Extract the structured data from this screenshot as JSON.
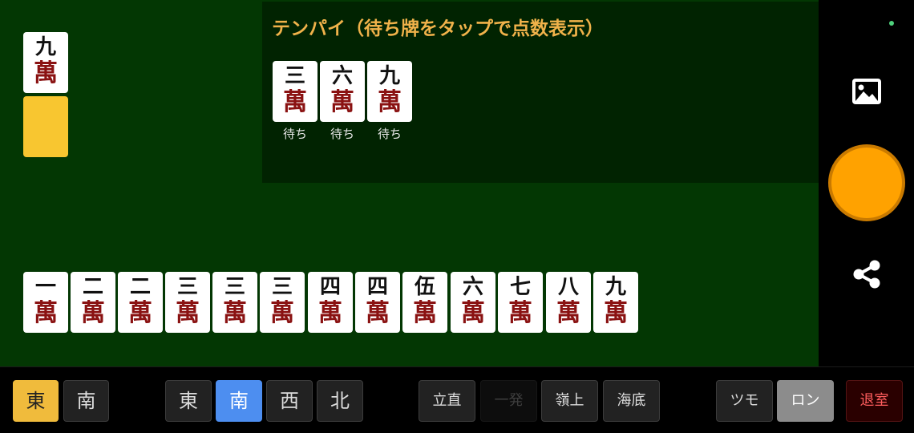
{
  "tenpai": {
    "title": "テンパイ（待ち牌をタップで点数表示）",
    "wait_label": "待ち",
    "waits": [
      {
        "num": "三",
        "suit": "萬"
      },
      {
        "num": "六",
        "suit": "萬"
      },
      {
        "num": "九",
        "suit": "萬"
      }
    ]
  },
  "dora_tile": {
    "num": "九",
    "suit": "萬"
  },
  "hand": [
    {
      "num": "一",
      "suit": "萬"
    },
    {
      "num": "二",
      "suit": "萬"
    },
    {
      "num": "二",
      "suit": "萬"
    },
    {
      "num": "三",
      "suit": "萬"
    },
    {
      "num": "三",
      "suit": "萬"
    },
    {
      "num": "三",
      "suit": "萬"
    },
    {
      "num": "四",
      "suit": "萬"
    },
    {
      "num": "四",
      "suit": "萬"
    },
    {
      "num": "伍",
      "suit": "萬"
    },
    {
      "num": "六",
      "suit": "萬"
    },
    {
      "num": "七",
      "suit": "萬"
    },
    {
      "num": "八",
      "suit": "萬"
    },
    {
      "num": "九",
      "suit": "萬"
    }
  ],
  "right_bar": {
    "icons": [
      "image-icon",
      "record-button",
      "share-icon"
    ],
    "status_dot_color": "#4ed07c",
    "record_color": "#ffa200"
  },
  "bottom": {
    "round_wind": [
      "東",
      "南"
    ],
    "seat_wind": [
      "東",
      "南",
      "西",
      "北"
    ],
    "yaku": [
      "立直",
      "一発",
      "嶺上",
      "海底"
    ],
    "win_type": [
      "ツモ",
      "ロン"
    ],
    "exit": "退室",
    "selected": {
      "round_wind": "東",
      "seat_wind": "南",
      "win_type": "ロン"
    },
    "disabled": [
      "一発"
    ]
  },
  "colors": {
    "table": "#033703",
    "tenpai_panel": "#012301",
    "title": "#f0b24a",
    "manzu": "#8a1212",
    "tile_back": "#f8c630",
    "selected_yellow": "#f0bb3c",
    "selected_blue": "#4d8ef0",
    "exit_text": "#ff5d5d"
  }
}
